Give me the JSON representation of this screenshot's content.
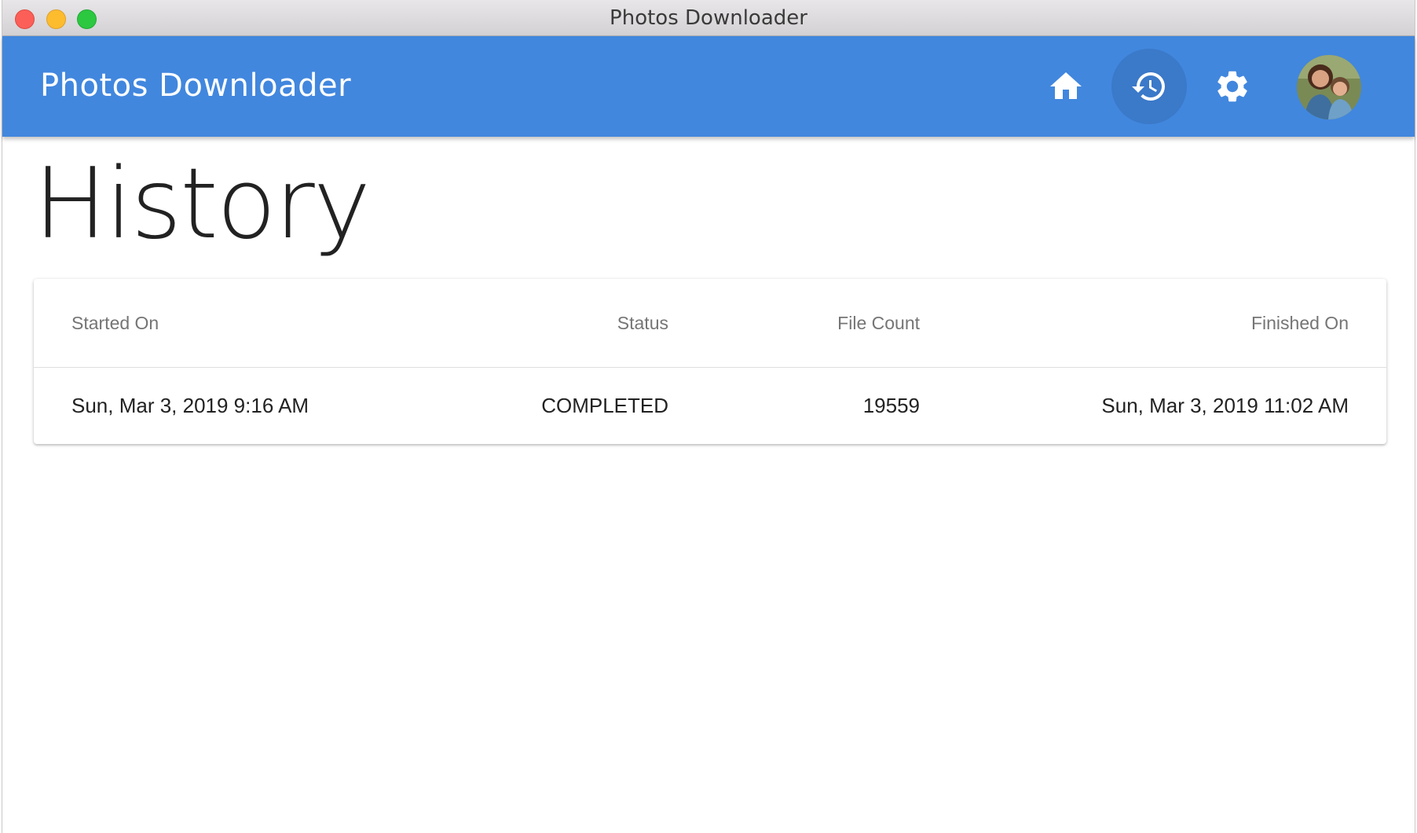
{
  "window": {
    "title": "Photos Downloader"
  },
  "appbar": {
    "title": "Photos Downloader",
    "colors": {
      "background": "#4187de",
      "active_button": "#3b79c9"
    },
    "nav": [
      {
        "icon": "home-icon",
        "active": false
      },
      {
        "icon": "history-icon",
        "active": true
      },
      {
        "icon": "gear-icon",
        "active": false
      }
    ],
    "avatar": "user-avatar"
  },
  "main": {
    "title": "History",
    "table": {
      "columns": [
        "Started On",
        "Status",
        "File Count",
        "Finished On"
      ],
      "rows": [
        {
          "started_on": "Sun, Mar 3, 2019 9:16 AM",
          "status": "COMPLETED",
          "file_count": "19559",
          "finished_on": "Sun, Mar 3, 2019 11:02 AM"
        }
      ]
    }
  }
}
